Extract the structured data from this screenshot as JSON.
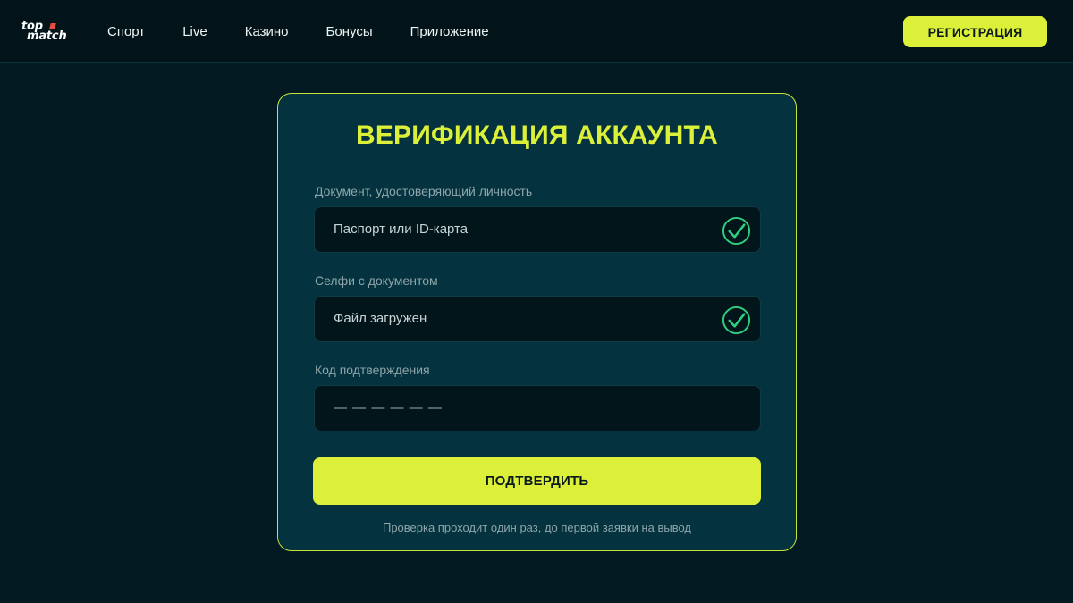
{
  "header": {
    "logo_top": "top",
    "logo_bottom": "match",
    "nav": [
      "Спорт",
      "Live",
      "Казино",
      "Бонусы",
      "Приложение"
    ],
    "register_label": "РЕГИСТРАЦИЯ"
  },
  "card": {
    "title": "ВЕРИФИКАЦИЯ АККАУНТА",
    "fields": [
      {
        "label": "Документ, удостоверяющий личность",
        "value": "Паспорт или ID-карта",
        "status": "check-circle-icon"
      },
      {
        "label": "Селфи с документом",
        "value": "Файл загружен",
        "status": "check-circle-icon"
      },
      {
        "label": "Код подтверждения",
        "placeholder": "— — — — — —"
      }
    ],
    "submit_label": "ПОДТВЕРДИТЬ",
    "note": "Проверка проходит один раз, до первой заявки на вывод"
  },
  "colors": {
    "accent": "#dcf03a",
    "success": "#2fd07f",
    "background": "#031a22",
    "card": "#04323f"
  }
}
